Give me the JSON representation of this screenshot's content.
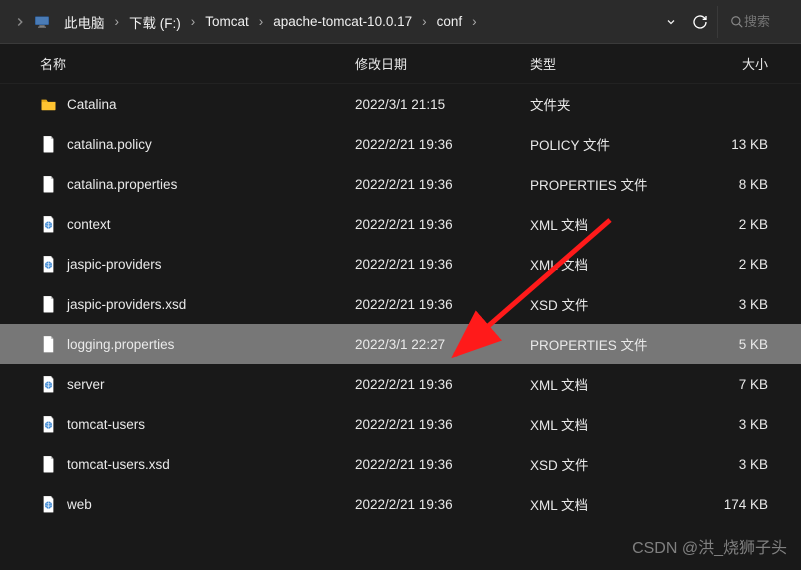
{
  "breadcrumb": [
    {
      "label": "此电脑"
    },
    {
      "label": "下载 (F:)"
    },
    {
      "label": "Tomcat"
    },
    {
      "label": "apache-tomcat-10.0.17"
    },
    {
      "label": "conf"
    }
  ],
  "search": {
    "placeholder": "搜索"
  },
  "columns": {
    "name": "名称",
    "date": "修改日期",
    "type": "类型",
    "size": "大小"
  },
  "files": [
    {
      "icon": "folder",
      "name": "Catalina",
      "date": "2022/3/1 21:15",
      "type": "文件夹",
      "size": "",
      "selected": false
    },
    {
      "icon": "file",
      "name": "catalina.policy",
      "date": "2022/2/21 19:36",
      "type": "POLICY 文件",
      "size": "13 KB",
      "selected": false
    },
    {
      "icon": "file",
      "name": "catalina.properties",
      "date": "2022/2/21 19:36",
      "type": "PROPERTIES 文件",
      "size": "8 KB",
      "selected": false
    },
    {
      "icon": "xml",
      "name": "context",
      "date": "2022/2/21 19:36",
      "type": "XML 文档",
      "size": "2 KB",
      "selected": false
    },
    {
      "icon": "xml",
      "name": "jaspic-providers",
      "date": "2022/2/21 19:36",
      "type": "XML 文档",
      "size": "2 KB",
      "selected": false
    },
    {
      "icon": "file",
      "name": "jaspic-providers.xsd",
      "date": "2022/2/21 19:36",
      "type": "XSD 文件",
      "size": "3 KB",
      "selected": false
    },
    {
      "icon": "file",
      "name": "logging.properties",
      "date": "2022/3/1 22:27",
      "type": "PROPERTIES 文件",
      "size": "5 KB",
      "selected": true
    },
    {
      "icon": "xml",
      "name": "server",
      "date": "2022/2/21 19:36",
      "type": "XML 文档",
      "size": "7 KB",
      "selected": false
    },
    {
      "icon": "xml",
      "name": "tomcat-users",
      "date": "2022/2/21 19:36",
      "type": "XML 文档",
      "size": "3 KB",
      "selected": false
    },
    {
      "icon": "file",
      "name": "tomcat-users.xsd",
      "date": "2022/2/21 19:36",
      "type": "XSD 文件",
      "size": "3 KB",
      "selected": false
    },
    {
      "icon": "xml",
      "name": "web",
      "date": "2022/2/21 19:36",
      "type": "XML 文档",
      "size": "174 KB",
      "selected": false
    }
  ],
  "watermark": "CSDN @洪_烧狮子头"
}
